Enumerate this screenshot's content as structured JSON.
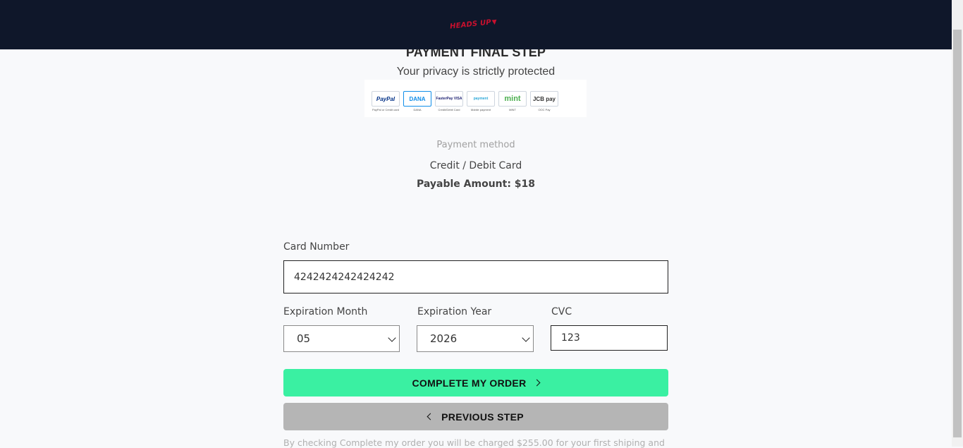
{
  "header": {
    "logo_text": "HEADS UP",
    "logo_mark": "▼"
  },
  "page": {
    "title": "PAYMENT FINAL STEP",
    "subtitle": "Your privacy is strictly protected"
  },
  "payment_logos": [
    {
      "name": "PayPal",
      "caption": "PayPal or Credit card",
      "color": "#003087"
    },
    {
      "name": "DANA",
      "caption": "DANA",
      "color": "#108ee9"
    },
    {
      "name": "FasterPay VISA",
      "caption": "Credit/Debit Card",
      "color": "#1a1f71"
    },
    {
      "name": "payment",
      "caption": "Mobile payment",
      "color": "#2aa7d8"
    },
    {
      "name": "mint",
      "caption": "MINT",
      "color": "#4caf50"
    },
    {
      "name": "JCB pay",
      "caption": "OOC Pay",
      "color": "#c8102e"
    }
  ],
  "method": {
    "label": "Payment method",
    "value": "Credit / Debit Card",
    "amount": "Payable Amount: $18"
  },
  "form": {
    "card_number_label": "Card Number",
    "card_number_value": "4242424242424242",
    "exp_month_label": "Expiration Month",
    "exp_month_value": "05",
    "exp_year_label": "Expiration Year",
    "exp_year_value": "2026",
    "cvc_label": "CVC",
    "cvc_value": "123"
  },
  "buttons": {
    "complete": "COMPLETE MY ORDER",
    "previous": "PREVIOUS STEP"
  },
  "disclaimer": "By checking Complete my order you will be charged $255.00 for your first shiping and",
  "colors": {
    "header_bg": "#0f172a",
    "brand_red": "#c8102e",
    "complete_button": "#3af0a2",
    "previous_button": "#b5b5b5"
  }
}
